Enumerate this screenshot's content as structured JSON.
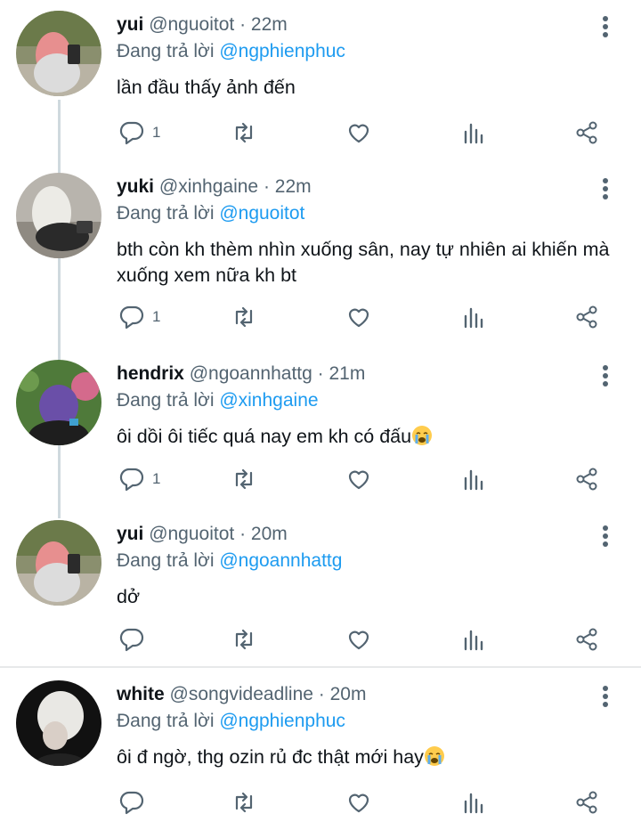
{
  "reply_prefix": "Đang trả lời",
  "tweets": [
    {
      "name": "yui",
      "handle": "@nguoitot",
      "time": "· 22m",
      "reply_to": "@ngphienphuc",
      "text": "lần đầu thấy ảnh đến",
      "reply_count": "1"
    },
    {
      "name": "yuki",
      "handle": "@xinhgaine",
      "time": "· 22m",
      "reply_to": "@nguoitot",
      "text": "bth còn kh thèm nhìn xuống sân, nay tự nhiên ai khiến mà xuống xem nữa kh bt",
      "reply_count": "1"
    },
    {
      "name": "hendrix",
      "handle": "@ngoannhattg",
      "time": "· 21m",
      "reply_to": "@xinhgaine",
      "text": "ôi dồi ôi tiếc quá nay em kh có đấu",
      "reply_count": "1"
    },
    {
      "name": "yui",
      "handle": "@nguoitot",
      "time": "· 20m",
      "reply_to": "@ngoannhattg",
      "text": "dở",
      "reply_count": ""
    },
    {
      "name": "white",
      "handle": "@songvideadline",
      "time": "· 20m",
      "reply_to": "@ngphienphuc",
      "text": "ôi đ ngờ, thg ozin rủ đc thật mới hay",
      "reply_count": ""
    }
  ],
  "icons": {
    "more": "more-vertical-icon",
    "reply": "reply-bubble-icon",
    "retweet": "retweet-icon",
    "like": "heart-icon",
    "views": "analytics-bars-icon",
    "share": "share-icon",
    "emoji": "loudly-crying-face-emoji"
  },
  "colors": {
    "mention": "#1d9bf0",
    "secondary_text": "#536471",
    "thread_line": "#cfd9de"
  }
}
